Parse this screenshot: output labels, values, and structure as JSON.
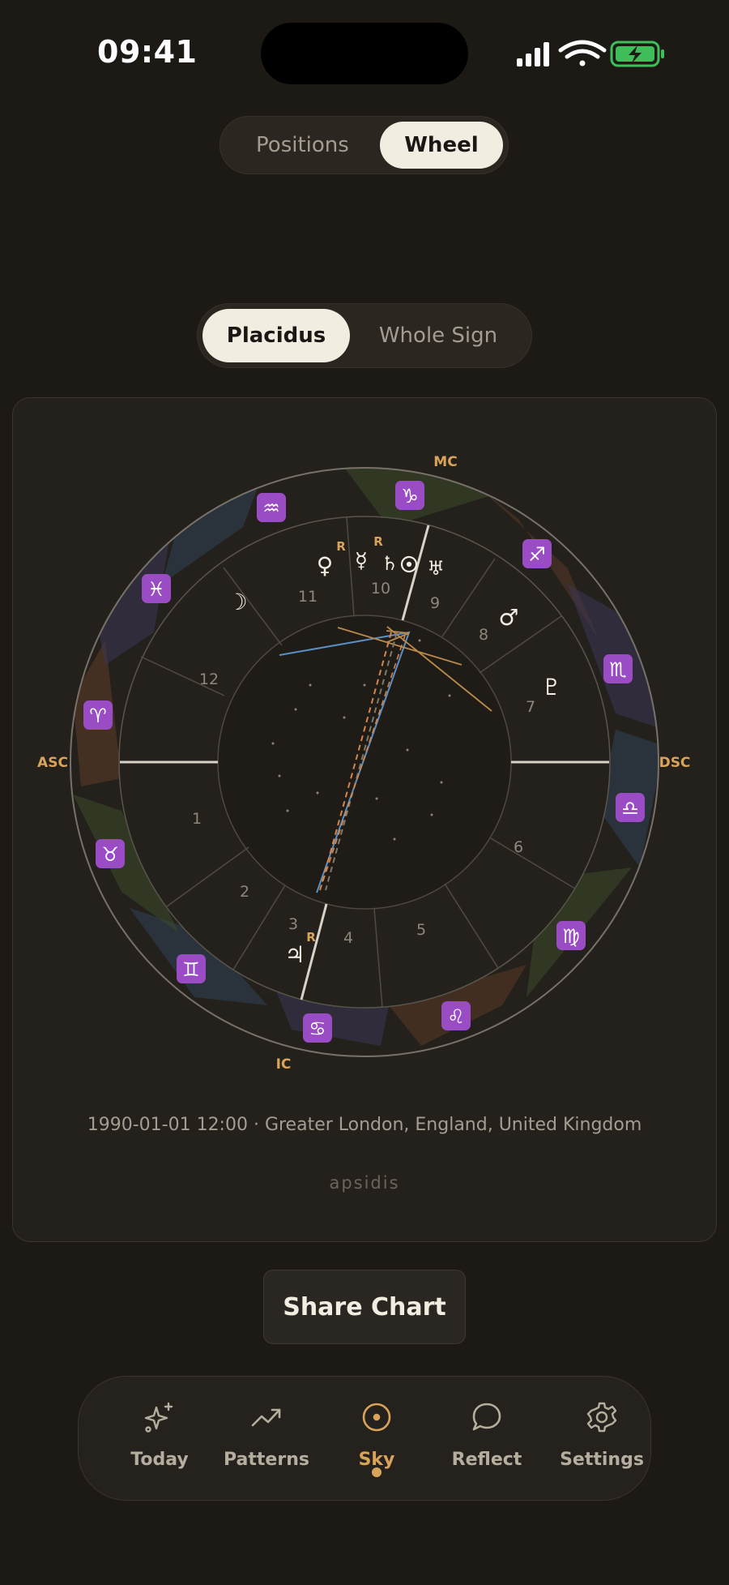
{
  "status_bar": {
    "time": "09:41"
  },
  "view_toggle": {
    "options": [
      "Positions",
      "Wheel"
    ],
    "selected": "Wheel"
  },
  "house_toggle": {
    "options": [
      "Placidus",
      "Whole Sign"
    ],
    "selected": "Placidus"
  },
  "chart": {
    "angles": {
      "mc": "MC",
      "asc": "ASC",
      "dsc": "DSC",
      "ic": "IC"
    },
    "house_numbers": [
      "1",
      "2",
      "3",
      "4",
      "5",
      "6",
      "7",
      "8",
      "9",
      "10",
      "11",
      "12"
    ],
    "zodiac_signs": [
      "♒",
      "♑",
      "♐",
      "♏",
      "♎",
      "♍",
      "♌",
      "♋",
      "♊",
      "♉",
      "♈",
      "♓"
    ],
    "planets": [
      "♀",
      "☿",
      "♄",
      "♅",
      "☽",
      "♂",
      "♇",
      "♃"
    ],
    "retrograde_marker": "R",
    "meta": "1990-01-01 12:00 · Greater London, England, United Kingdom",
    "brand": "apsidis",
    "colors": {
      "accent": "#d9a35a",
      "sign_tile": "#9a4cc4",
      "aspect_blue": "#5b8fc4",
      "aspect_orange": "#d4854a"
    }
  },
  "share_button": {
    "label": "Share Chart"
  },
  "tab_bar": {
    "tabs": [
      {
        "label": "Today",
        "icon": "sparkles-icon"
      },
      {
        "label": "Patterns",
        "icon": "trending-up-icon"
      },
      {
        "label": "Sky",
        "icon": "target-icon"
      },
      {
        "label": "Reflect",
        "icon": "chat-bubble-icon"
      },
      {
        "label": "Settings",
        "icon": "gear-icon"
      }
    ],
    "active": "Sky"
  }
}
